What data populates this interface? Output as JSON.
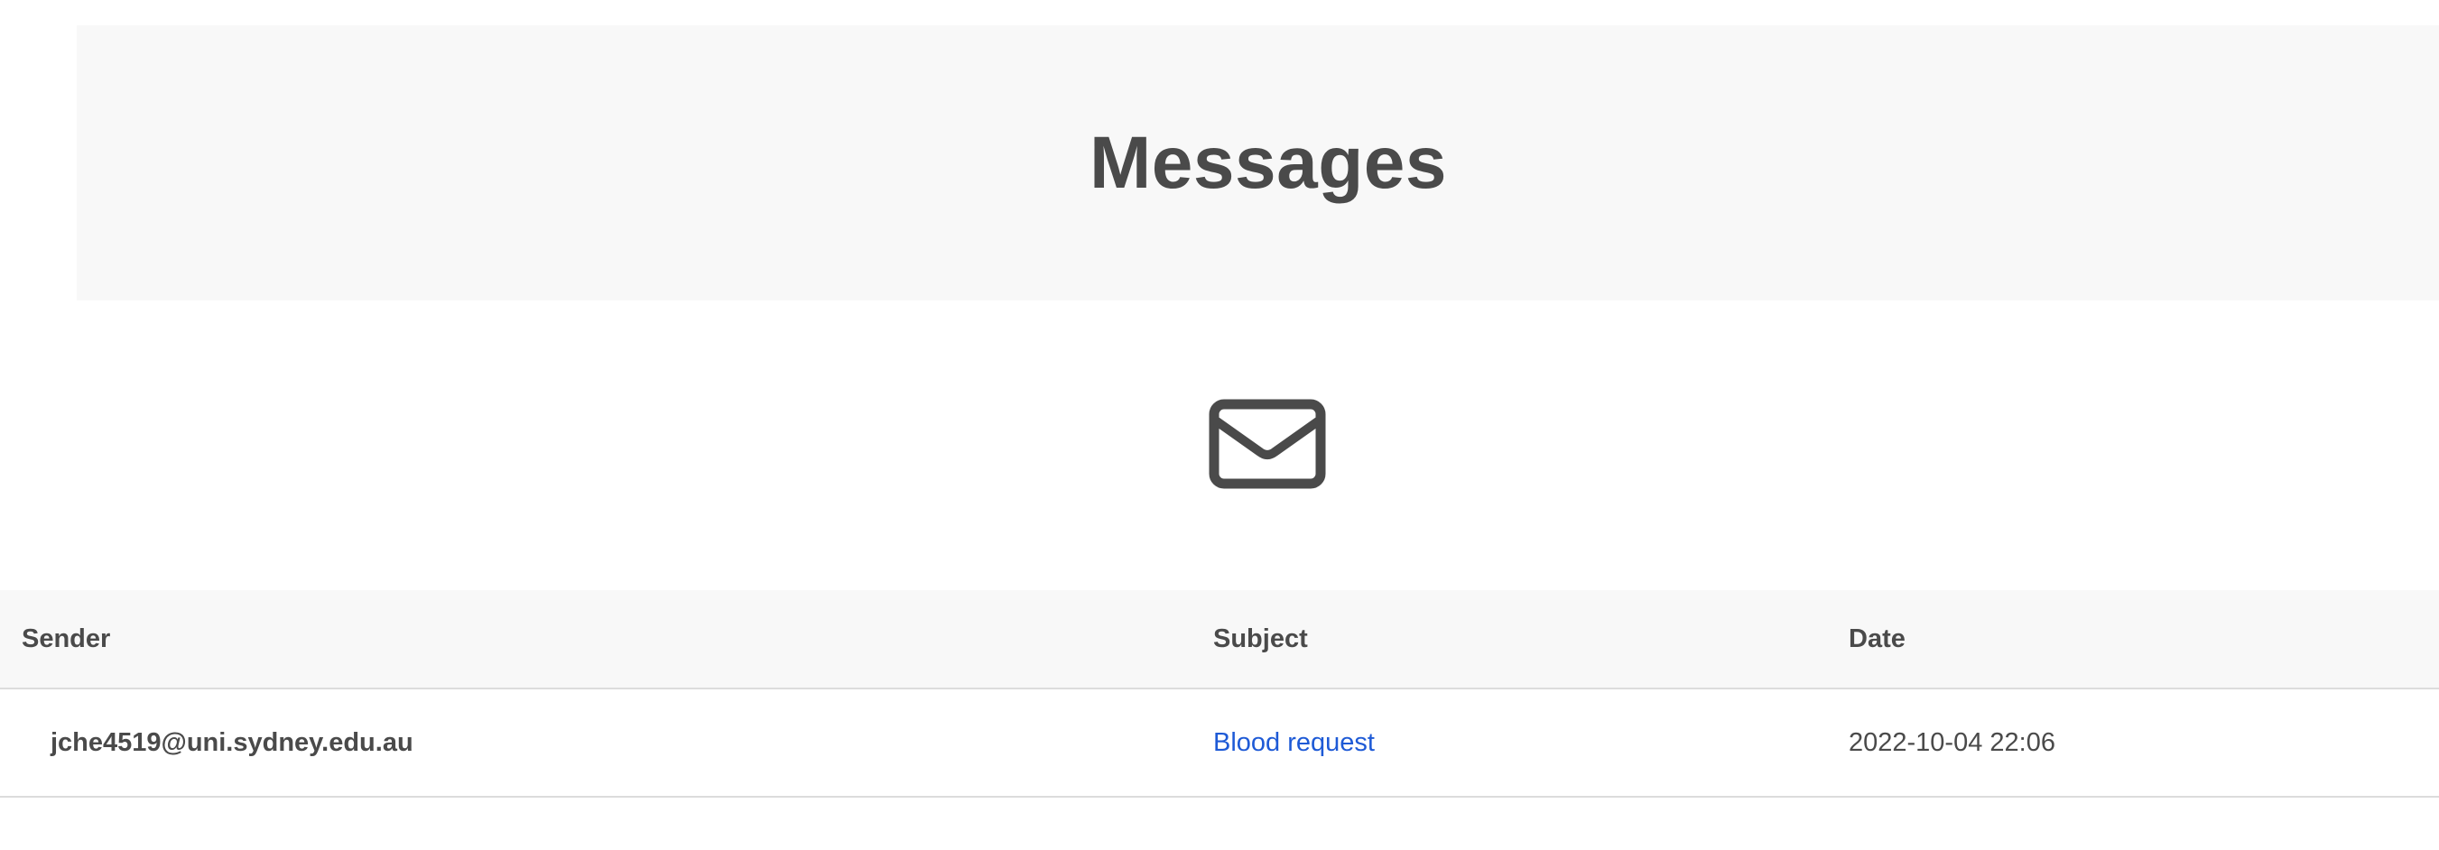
{
  "header": {
    "title": "Messages"
  },
  "icons": {
    "mail": "envelope-icon"
  },
  "colors": {
    "hero_background": "#f8f8f8",
    "text": "#4a4a4a",
    "link": "#1e5ad6",
    "divider": "#dcdcdc"
  },
  "table": {
    "columns": {
      "sender": "Sender",
      "subject": "Subject",
      "date": "Date"
    },
    "rows": [
      {
        "sender": "jche4519@uni.sydney.edu.au",
        "subject": "Blood request",
        "date": "2022-10-04 22:06"
      }
    ]
  }
}
